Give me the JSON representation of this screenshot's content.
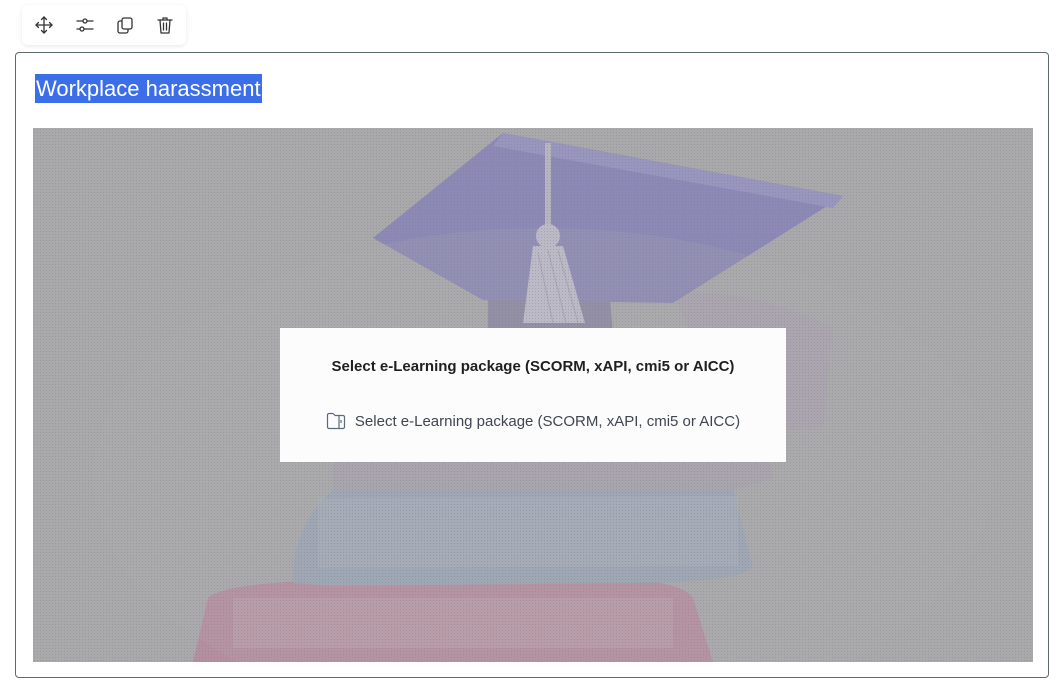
{
  "toolbar": {
    "icons": [
      "move-icon",
      "settings-sliders-icon",
      "duplicate-icon",
      "trash-icon"
    ]
  },
  "block": {
    "title": "Workplace harassment"
  },
  "media": {
    "background": "graduation-cap-and-books-illustration",
    "dialog": {
      "title": "Select e-Learning package (SCORM, xAPI, cmi5 or AICC)",
      "link_label": "Select e-Learning package (SCORM, xAPI, cmi5 or AICC)",
      "link_icon": "folder-icon"
    }
  },
  "colors": {
    "title_highlight": "#3b6ee8",
    "border": "#5c6b6b",
    "overlay": "#a9a8ab"
  }
}
